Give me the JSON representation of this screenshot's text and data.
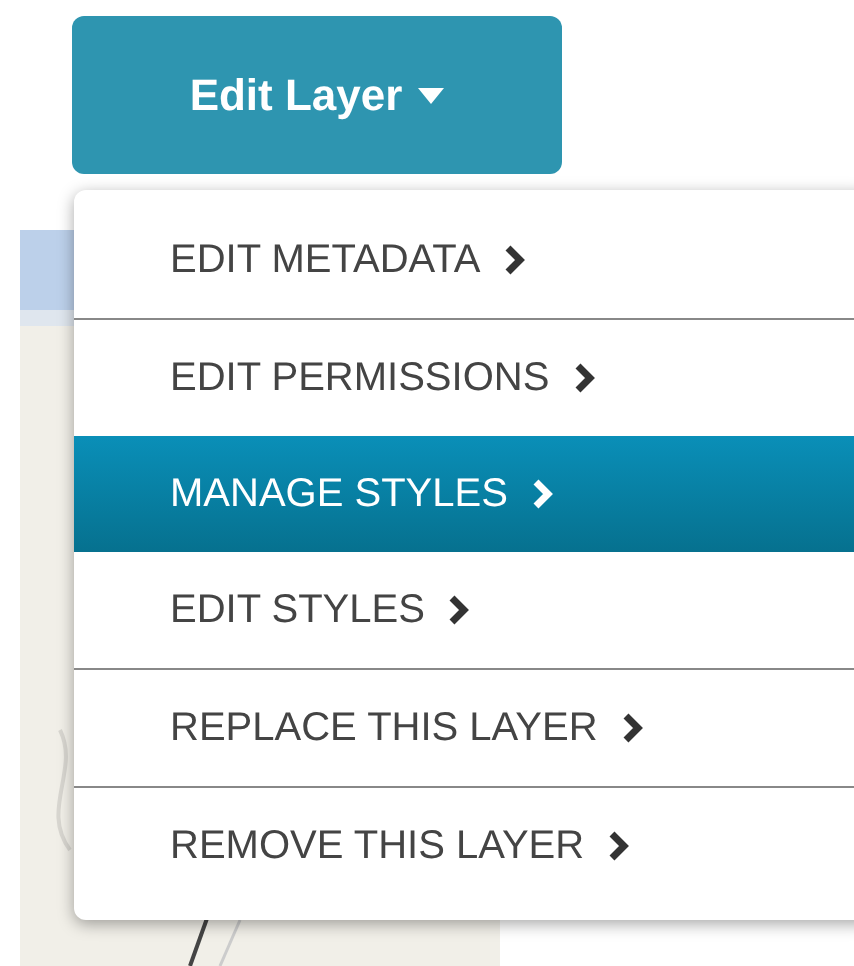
{
  "button": {
    "label": "Edit Layer",
    "expanded": true
  },
  "menu": {
    "items": [
      {
        "label": "EDIT METADATA",
        "selected": false
      },
      {
        "label": "EDIT PERMISSIONS",
        "selected": false
      },
      {
        "label": "MANAGE STYLES",
        "selected": true
      },
      {
        "label": "EDIT STYLES",
        "selected": false
      },
      {
        "label": "REPLACE THIS LAYER",
        "selected": false
      },
      {
        "label": "REMOVE THIS LAYER",
        "selected": false
      }
    ]
  }
}
